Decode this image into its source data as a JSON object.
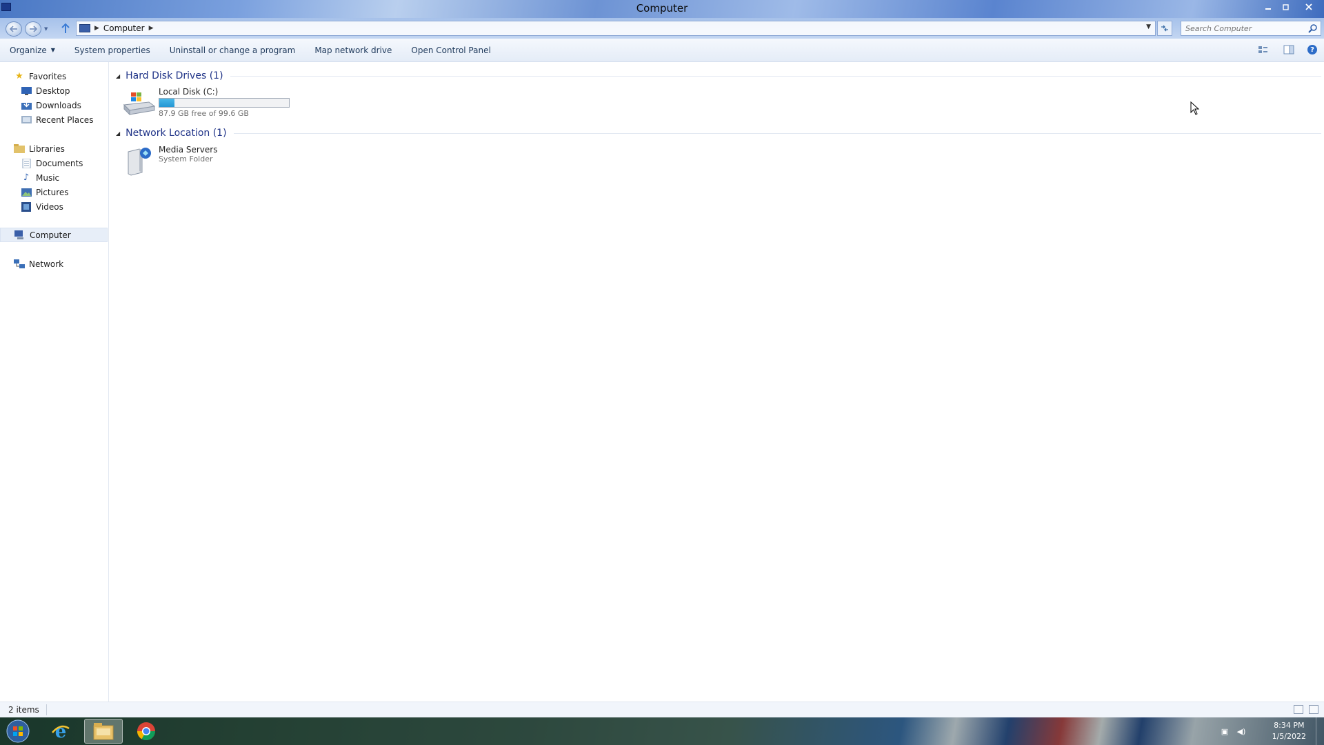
{
  "window": {
    "title": "Computer"
  },
  "address": {
    "crumbs": [
      "Computer"
    ],
    "search_placeholder": "Search Computer"
  },
  "toolbar": {
    "organize": "Organize",
    "system_properties": "System properties",
    "uninstall": "Uninstall or change a program",
    "map_network_drive": "Map network drive",
    "open_control_panel": "Open Control Panel"
  },
  "nav": {
    "favorites": {
      "label": "Favorites",
      "items": [
        "Desktop",
        "Downloads",
        "Recent Places"
      ]
    },
    "libraries": {
      "label": "Libraries",
      "items": [
        "Documents",
        "Music",
        "Pictures",
        "Videos"
      ]
    },
    "computer": "Computer",
    "network": "Network"
  },
  "content": {
    "hard_disk_header": "Hard Disk Drives (1)",
    "local_disk": {
      "name": "Local Disk (C:)",
      "free_text": "87.9 GB free of 99.6 GB",
      "used_fraction": 0.117
    },
    "network_header": "Network Location (1)",
    "media_servers": {
      "name": "Media Servers",
      "type": "System Folder"
    }
  },
  "status": {
    "count": "2 items"
  },
  "taskbar": {
    "time": "8:34 PM",
    "date": "1/5/2022"
  },
  "colors": {
    "group_header": "#1e3287",
    "capacity_fill": "#2597d4"
  }
}
